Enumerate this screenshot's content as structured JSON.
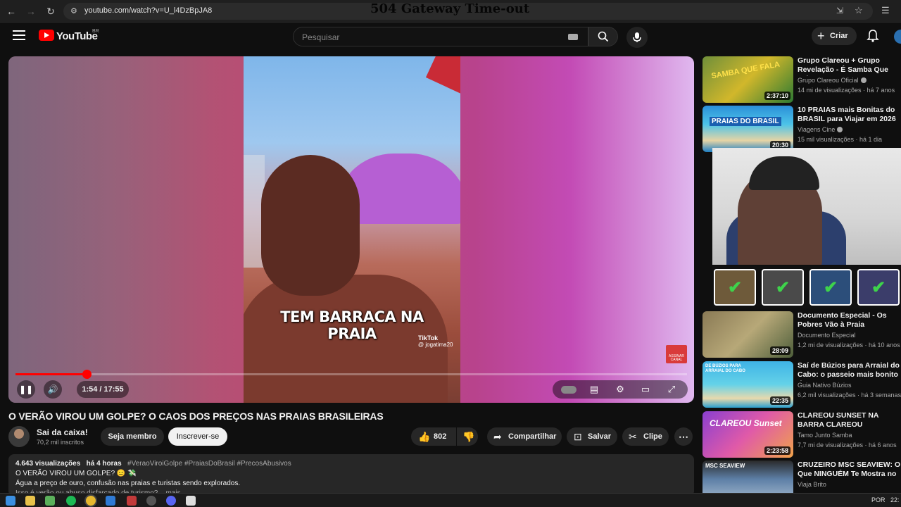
{
  "browser": {
    "url": "youtube.com/watch?v=U_l4DzBpJA8",
    "overlay_text": "504 Gateway Time-out"
  },
  "header": {
    "logo_text": "YouTube",
    "country_code": "BR",
    "search_placeholder": "Pesquisar",
    "create_label": "Criar"
  },
  "player": {
    "caption": "TEM BARRACA NA PRAIA",
    "tiktok_brand": "TikTok",
    "tiktok_handle": "@ jogatima20",
    "subscribe_badge": "ASSINAR CANAL",
    "time": "1:54 / 17:55",
    "progress_fraction": 0.106
  },
  "video": {
    "title": "O VERÃO VIROU UM GOLPE? O CAOS DOS PREÇOS NAS PRAIAS BRASILEIRAS",
    "channel_name": "Sai da caixa!",
    "channel_subs": "70,2 mil inscritos",
    "member_label": "Seja membro",
    "subscribe_label": "Inscrever-se",
    "likes": "802",
    "share_label": "Compartilhar",
    "save_label": "Salvar",
    "clip_label": "Clipe"
  },
  "description": {
    "views": "4.643 visualizações",
    "age": "há 4 horas",
    "tags": "#VeraoViroiGolpe #PraiasDoBrasil #PrecosAbusivos",
    "line1": "O VERÃO VIROU UM GOLPE? 😐 💸",
    "line2": "Água a preço de ouro, confusão nas praias e turistas sendo explorados.",
    "line3": "Isso é verão ou abuso disfarçado de turismo? ...mais"
  },
  "sidebar": {
    "items": [
      {
        "title": "Grupo Clareou + Grupo Revelação - É Samba Que Fala",
        "channel": "Grupo Clareou Oficial",
        "meta": "14 mi de visualizações · há 7 anos",
        "duration": "2:37:10",
        "thumb_text": "SAMBA QUE FALA"
      },
      {
        "title": "10 PRAIAS mais Bonitas do BRASIL para Viajar em 2026",
        "channel": "Viagens Cine",
        "meta": "15 mil visualizações · há 1 dia",
        "duration": "20:30",
        "thumb_text": "PRAIAS DO BRASIL"
      },
      {
        "title": "Documento Especial - Os Pobres Vão à Praia",
        "channel": "Documento Especial",
        "meta": "1,2 mi de visualizações · há 10 anos",
        "duration": "28:09",
        "thumb_text": ""
      },
      {
        "title": "Saí de Búzios para Arraial do Cabo: o passeio mais bonito d",
        "channel": "Guia Nativo Búzios",
        "meta": "6,2 mil visualizações · há 3 semanas",
        "duration": "22:35",
        "thumb_text": "DE BÚZIOS PARA ARRAIAL DO CABO"
      },
      {
        "title": "CLAREOU SUNSET NA BARRA CLAREOU",
        "channel": "Tamo Junto Samba",
        "meta": "7,7 mi de visualizações · há 6 anos",
        "duration": "2:23:58",
        "thumb_text": "CLAREOU Sunset"
      },
      {
        "title": "CRUZEIRO MSC SEAVIEW: O Que NINGUÉM Te Mostra no ...",
        "channel": "Viaja Brito",
        "meta": "",
        "duration": "",
        "thumb_text": "MSC SEAVIEW"
      }
    ]
  },
  "taskbar": {
    "lang": "POR",
    "time": "22:"
  },
  "colors": {
    "accent": "#ff0000",
    "background": "#0f0f0f"
  }
}
